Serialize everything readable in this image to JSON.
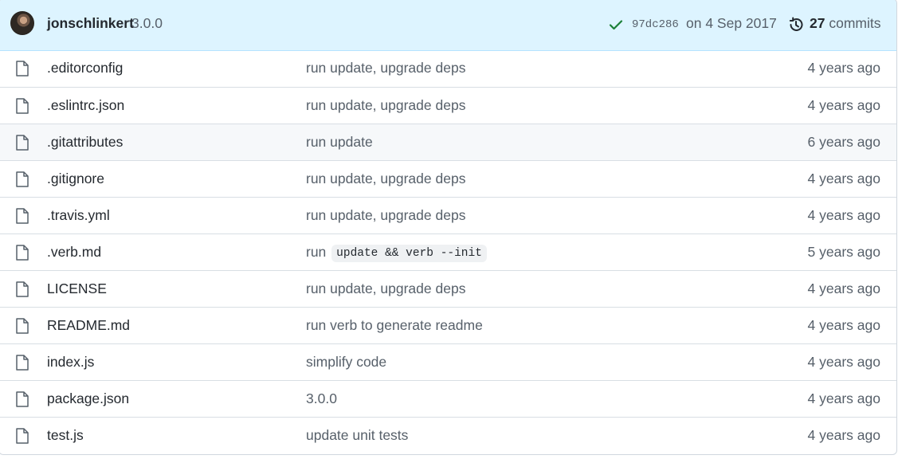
{
  "latest_commit": {
    "author": "jonschlinkert",
    "message": "3.0.0",
    "status_icon": "check-icon",
    "sha": "97dc286",
    "date": "on 4 Sep 2017",
    "commit_count": "27",
    "commits_label": "commits",
    "history_icon": "history-icon"
  },
  "files": [
    {
      "name": ".editorconfig",
      "message": "run update, upgrade deps",
      "age": "4 years ago",
      "icon": "file-icon"
    },
    {
      "name": ".eslintrc.json",
      "message": "run update, upgrade deps",
      "age": "4 years ago",
      "icon": "file-icon"
    },
    {
      "name": ".gitattributes",
      "message": "run update",
      "age": "6 years ago",
      "icon": "file-icon"
    },
    {
      "name": ".gitignore",
      "message": "run update, upgrade deps",
      "age": "4 years ago",
      "icon": "file-icon"
    },
    {
      "name": ".travis.yml",
      "message": "run update, upgrade deps",
      "age": "4 years ago",
      "icon": "file-icon"
    },
    {
      "name": ".verb.md",
      "message_prefix": "run",
      "message_code": "update && verb --init",
      "age": "5 years ago",
      "icon": "file-icon"
    },
    {
      "name": "LICENSE",
      "message": "run update, upgrade deps",
      "age": "4 years ago",
      "icon": "file-icon"
    },
    {
      "name": "README.md",
      "message": "run verb to generate readme",
      "age": "4 years ago",
      "icon": "file-icon"
    },
    {
      "name": "index.js",
      "message": "simplify code",
      "age": "4 years ago",
      "icon": "file-icon"
    },
    {
      "name": "package.json",
      "message": "3.0.0",
      "age": "4 years ago",
      "icon": "file-icon"
    },
    {
      "name": "test.js",
      "message": "update unit tests",
      "age": "4 years ago",
      "icon": "file-icon"
    }
  ],
  "colors": {
    "header_bg": "#ddf4ff",
    "success": "#1a7f37",
    "muted_text": "#57606a",
    "default_text": "#24292f",
    "hover_row": "#f6f8fa"
  }
}
